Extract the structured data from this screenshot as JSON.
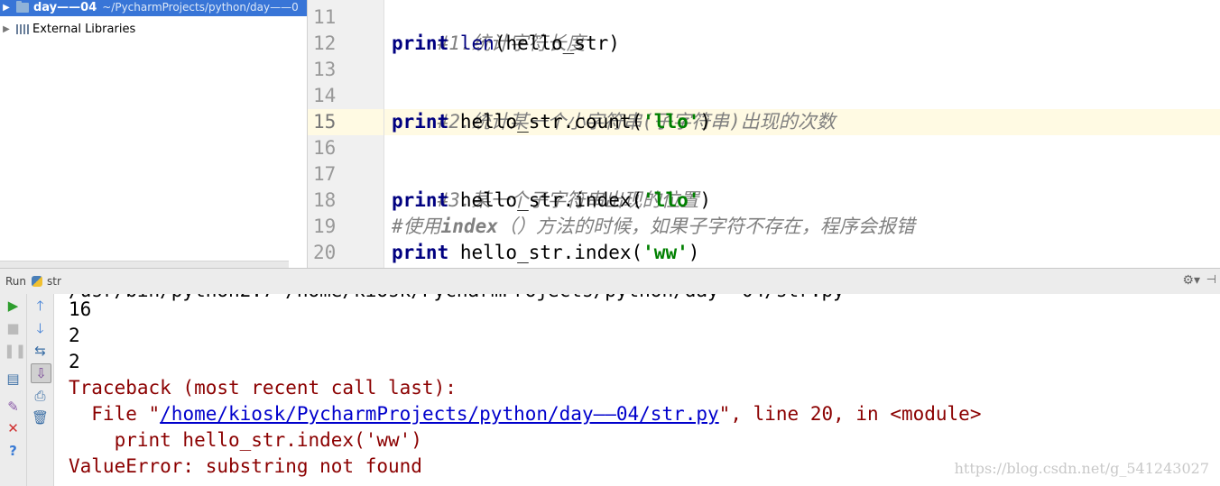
{
  "project_tree": {
    "items": [
      {
        "label": "day——04",
        "path": "~/PycharmProjects/python/day——0",
        "expanded": false
      },
      {
        "label": "External Libraries",
        "expanded": false
      }
    ]
  },
  "editor": {
    "current_line": "15",
    "line_numbers": [
      "11",
      "12",
      "13",
      "14",
      "15",
      "16",
      "17",
      "18",
      "19",
      "20"
    ],
    "code": {
      "l11_comment": "#1.统计字符长度",
      "l12_kw": "print",
      "l12_fn": "len",
      "l12_rest": "(hello_str)",
      "l14_comment": "#2.统计某一个小字符串(子字符串)出现的次数",
      "l15_kw": "print",
      "l15_a": " hello_str.count(",
      "l15_str": "'llo'",
      "l15_b": ")",
      "l17_comment": "#3.某一个子字符串出现的位置",
      "l18_kw": "print",
      "l18_a": " hello_str.index(",
      "l18_str": "'llo'",
      "l18_b": ")",
      "l19_comment_a": "#使用",
      "l19_comment_b": "index",
      "l19_comment_c": "（）方法的时候，如果子字符不存在，程序会报错",
      "l20_kw": "print",
      "l20_a": " hello_str.index(",
      "l20_str": "'ww'",
      "l20_b": ")"
    }
  },
  "run_window": {
    "title": "Run",
    "config": "str",
    "output": {
      "lines": [
        "16",
        "2",
        "2"
      ],
      "traceback": "Traceback (most recent call last):",
      "file_prefix": "  File \"",
      "file_link": "/home/kiosk/PycharmProjects/python/day——04/str.py",
      "file_suffix": "\", line 20, in <module>",
      "code_line": "    print hello_str.index('ww')",
      "error": "ValueError: substring not found"
    },
    "watermark": "https://blog.csdn.net/g_541243027"
  },
  "icons": {
    "run": "play-icon",
    "stop": "stop-icon",
    "pause": "pause-icon",
    "up": "arrow-up-icon",
    "down": "arrow-down-icon"
  }
}
